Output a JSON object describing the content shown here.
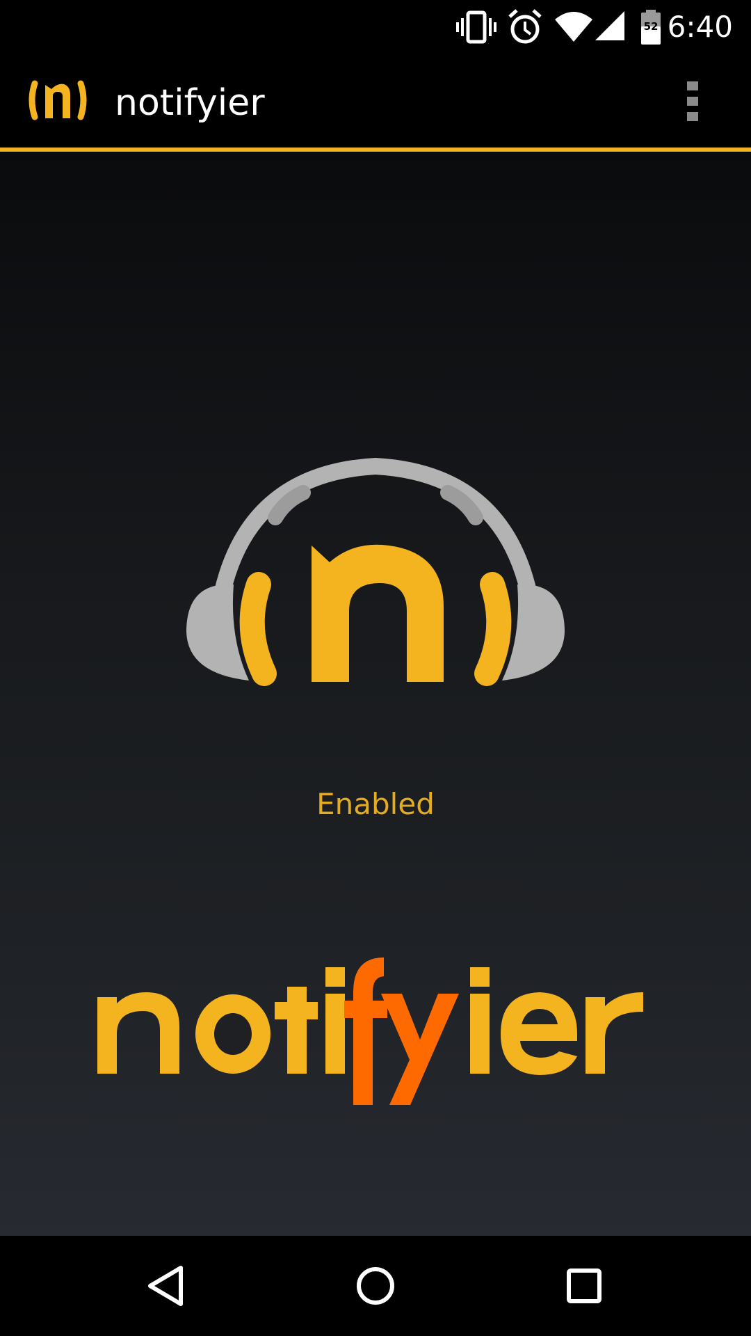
{
  "status_bar": {
    "time": "6:40",
    "battery_level": "52",
    "icons": [
      "vibrate-icon",
      "alarm-icon",
      "wifi-icon",
      "cell-signal-icon",
      "battery-icon"
    ]
  },
  "toolbar": {
    "title": "notifyier",
    "logo_icon": "notifyier-logo-icon",
    "menu_icon": "overflow-menu-icon"
  },
  "main": {
    "status_text": "Enabled",
    "hero_icon": "headphones-logo-icon",
    "wordmark": "notifyier"
  },
  "nav_bar": {
    "back_icon": "back-icon",
    "home_icon": "home-icon",
    "recents_icon": "recents-icon"
  },
  "colors": {
    "accent": "#f3b420",
    "highlight": "#ff6a00",
    "headphone_gray": "#b3b3b3",
    "bar_background": "#000000"
  }
}
